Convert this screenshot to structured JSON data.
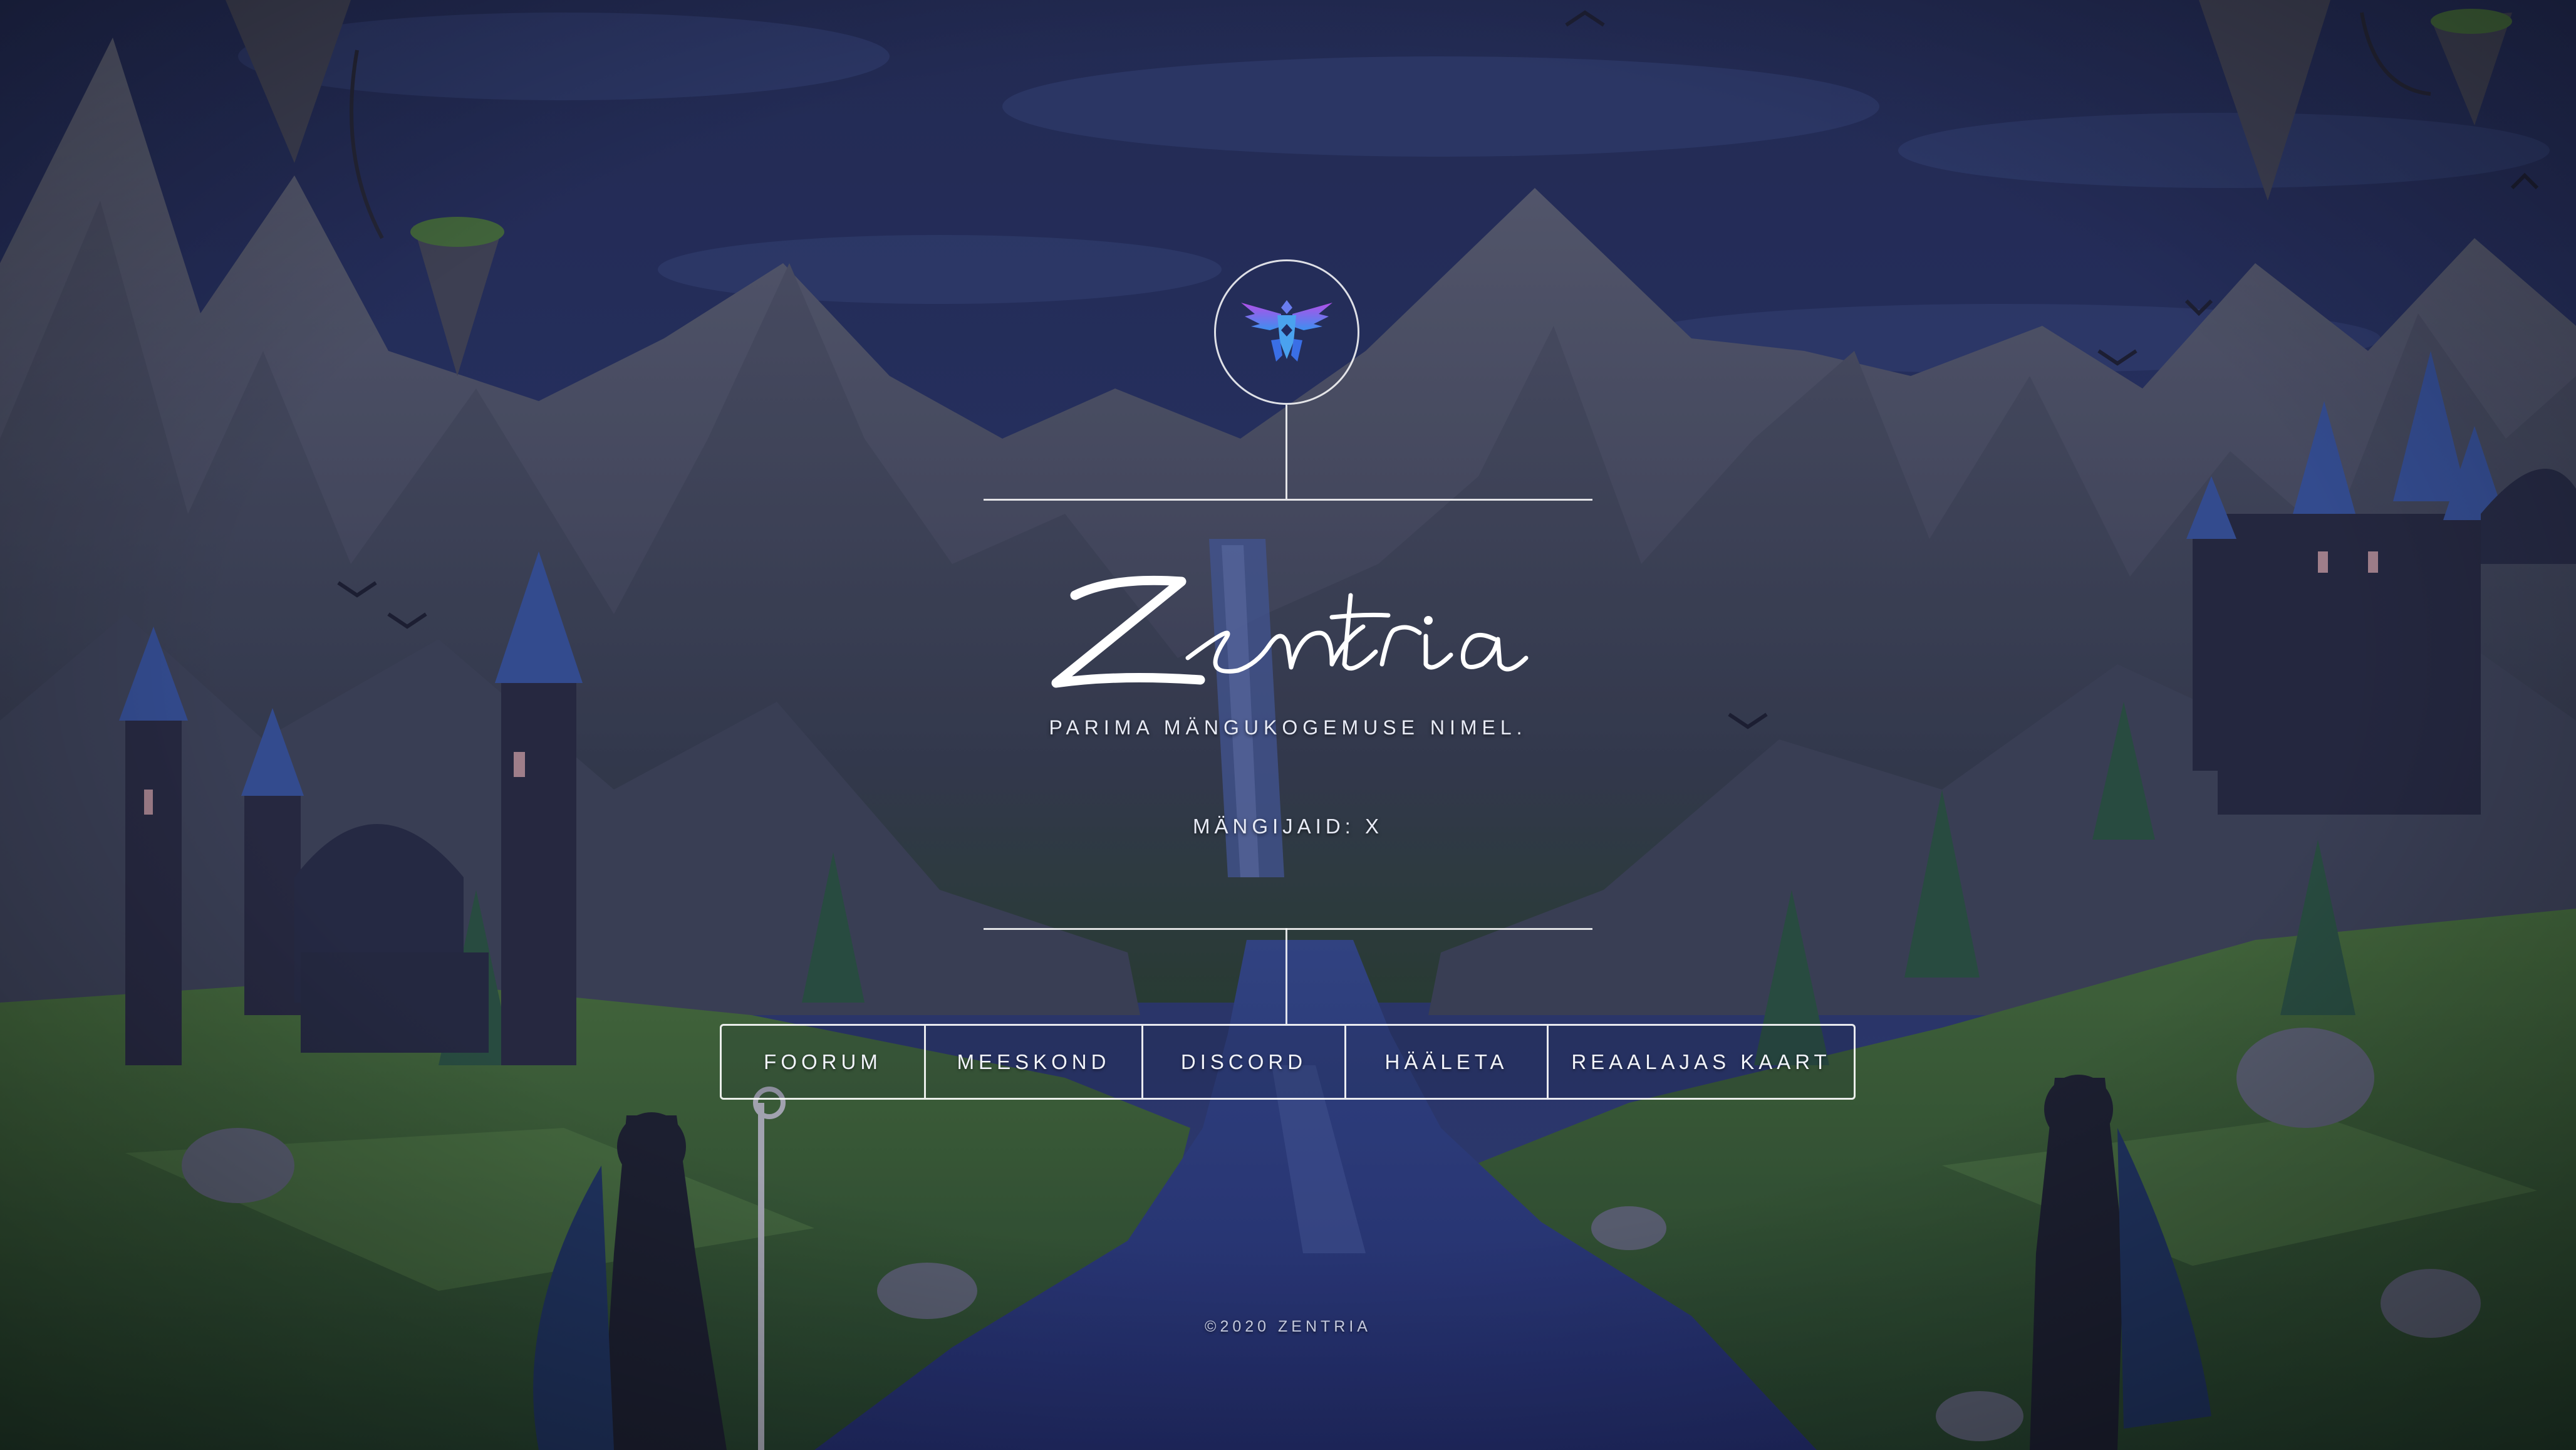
{
  "hero": {
    "title": "Zentria",
    "tagline": "PARIMA MÄNGUKOGEMUSE NIMEL.",
    "player_count": "MÄNGIJAID: X",
    "logo_icon": "phoenix-emblem-icon"
  },
  "nav": {
    "items": [
      {
        "label": "FOORUM"
      },
      {
        "label": "MEESKOND"
      },
      {
        "label": "DISCORD"
      },
      {
        "label": "HÄÄLETA"
      },
      {
        "label": "REAALAJAS KAART"
      }
    ]
  },
  "footer": {
    "copyright": "©2020 ZENTRIA"
  },
  "colors": {
    "sky": "#29346a",
    "mountain": "#4b4e63",
    "grass": "#3f6a3c",
    "river": "#2b3f86",
    "emblem_purple": "#9a4ce6",
    "emblem_blue": "#3fa6ee"
  },
  "background": {
    "scene_icon": "fantasy-landscape-background"
  }
}
